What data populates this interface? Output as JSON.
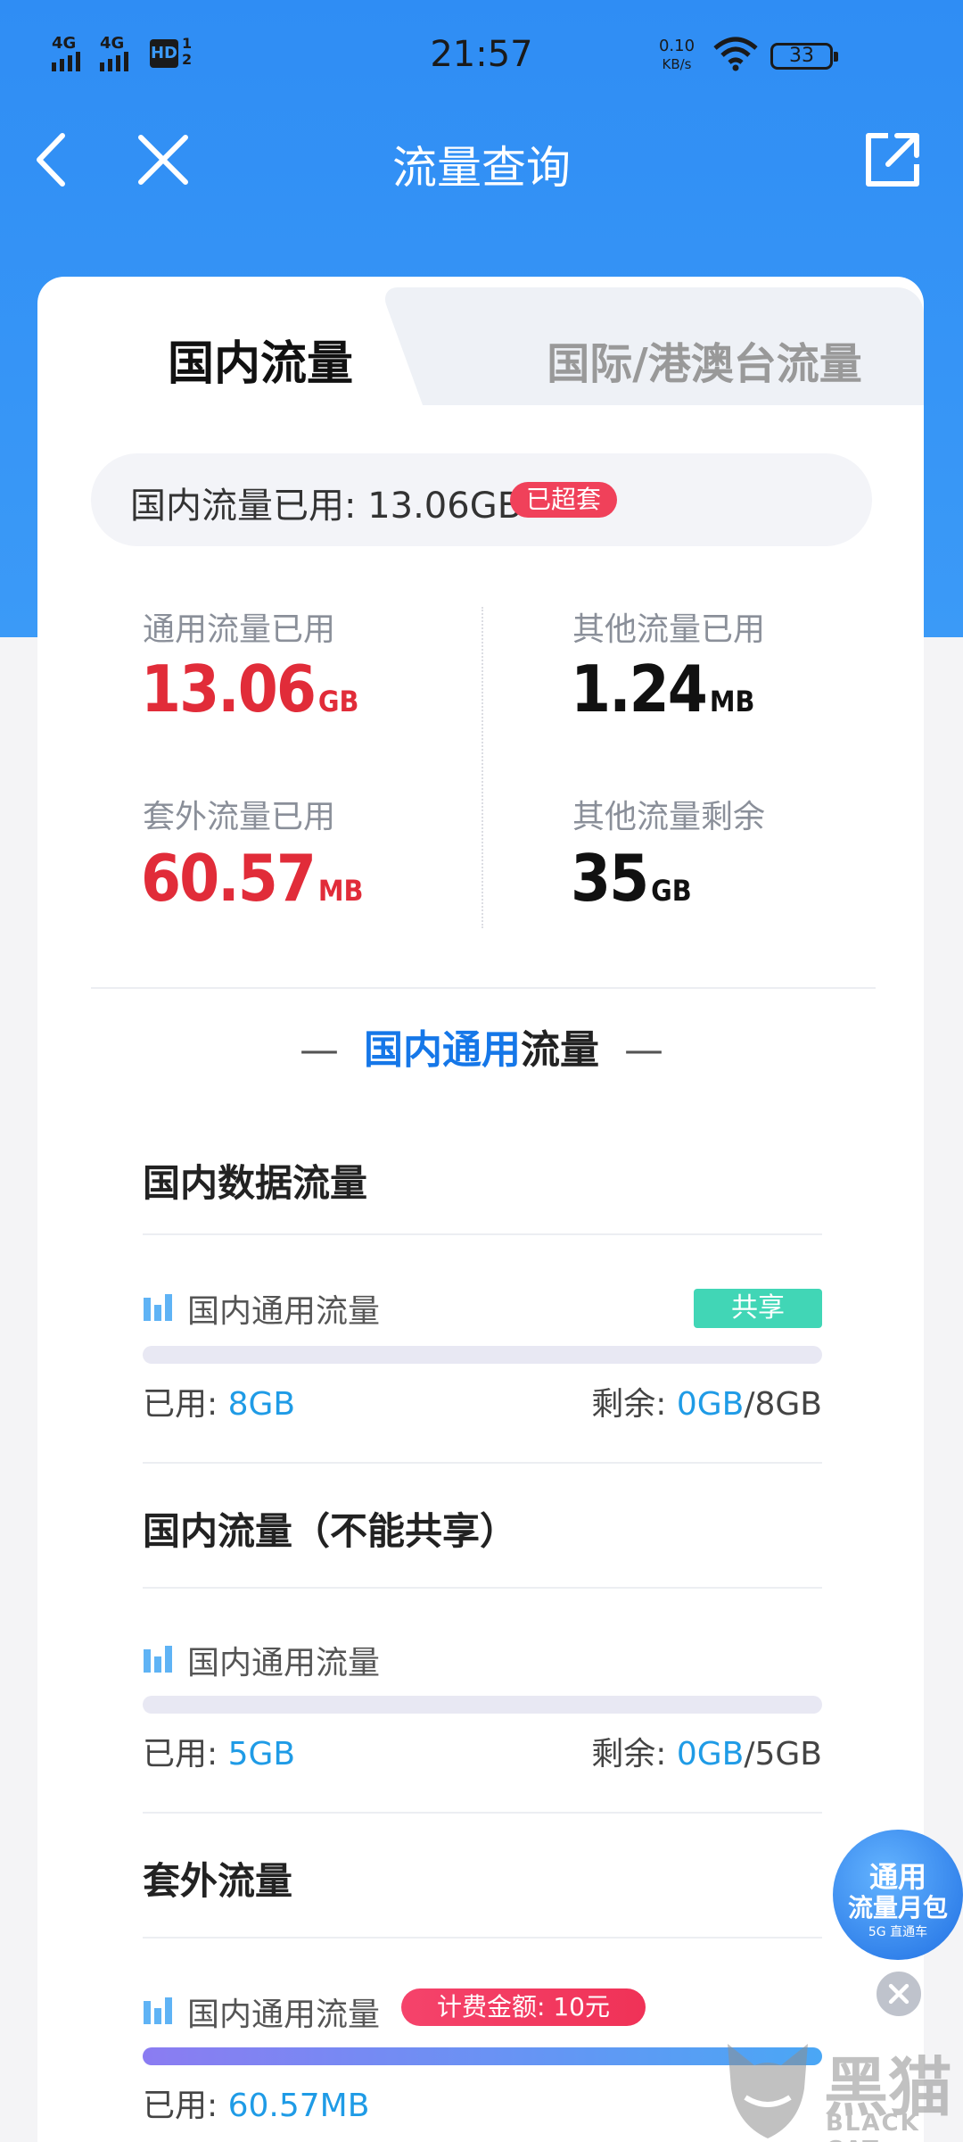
{
  "status_bar": {
    "signal1": "4G",
    "signal2": "4G",
    "hd": "HD",
    "hd_sub": "1 2",
    "time": "21:57",
    "speed_value": "0.10",
    "speed_unit": "KB/s",
    "battery": "33"
  },
  "nav": {
    "title": "流量查询",
    "back_icon": "chevron-left-icon",
    "close_icon": "close-icon",
    "share_icon": "share-external-icon"
  },
  "tabs": [
    {
      "label": "国内流量",
      "active": true
    },
    {
      "label": "国际/港澳台流量",
      "active": false
    }
  ],
  "summary": {
    "text": "国内流量已用: 13.06GB",
    "badge": "已超套"
  },
  "stats": [
    {
      "label": "通用流量已用",
      "value": "13.06",
      "unit": "GB",
      "color": "#e12c39"
    },
    {
      "label": "其他流量已用",
      "value": "1.24",
      "unit": "MB",
      "color": "#111111"
    },
    {
      "label": "套外流量已用",
      "value": "60.57",
      "unit": "MB",
      "color": "#e12c39"
    },
    {
      "label": "其他流量剩余",
      "value": "35",
      "unit": "GB",
      "color": "#111111"
    }
  ],
  "section": {
    "dash_left": "—",
    "title_blue": "国内通用",
    "title_black": "流量",
    "dash_right": "—"
  },
  "groups": [
    {
      "title": "国内数据流量",
      "item": {
        "label": "国内通用流量",
        "tag": "共享",
        "used_label": "已用: ",
        "used_value": "8GB",
        "rest_label": "剩余: ",
        "rest_value": "0GB",
        "rest_total": "/8GB",
        "progress": 0
      }
    },
    {
      "title": "国内流量（不能共享）",
      "item": {
        "label": "国内通用流量",
        "used_label": "已用: ",
        "used_value": "5GB",
        "rest_label": "剩余: ",
        "rest_value": "0GB",
        "rest_total": "/5GB",
        "progress": 0
      }
    },
    {
      "title": "套外流量",
      "item": {
        "label": "国内通用流量",
        "tag": "计费金额: 10元",
        "used_label": "已用: ",
        "used_value": "60.57MB",
        "progress": 1
      }
    }
  ],
  "float_badge": {
    "line1": "通用",
    "line2": "流量月包",
    "line3": "5G 直通车"
  },
  "watermark": {
    "cn": "黑猫",
    "en": "BLACK CAT"
  }
}
